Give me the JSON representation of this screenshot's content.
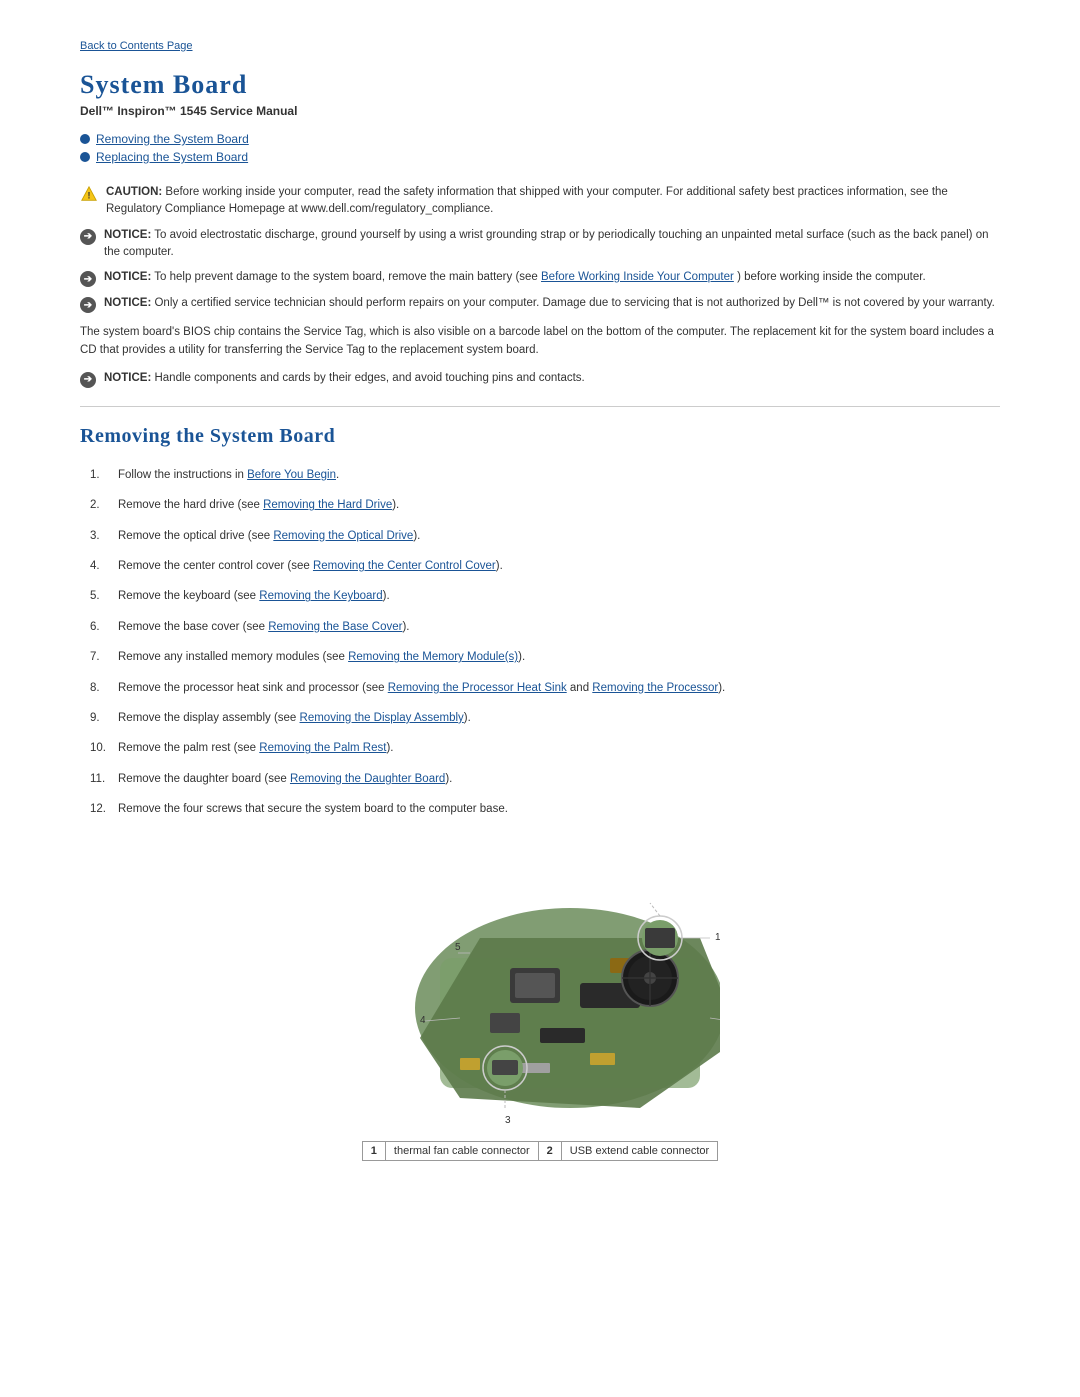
{
  "back_link": "Back to Contents Page",
  "page_title": "System Board",
  "subtitle": "Dell™ Inspiron™ 1545 Service Manual",
  "toc": [
    {
      "label": "Removing the System Board",
      "href": "#removing"
    },
    {
      "label": "Replacing the System Board",
      "href": "#replacing"
    }
  ],
  "notices": [
    {
      "type": "caution",
      "label": "CAUTION:",
      "text": "Before working inside your computer, read the safety information that shipped with your computer. For additional safety best practices information, see the Regulatory Compliance Homepage at www.dell.com/regulatory_compliance."
    },
    {
      "type": "notice",
      "label": "NOTICE:",
      "text": "To avoid electrostatic discharge, ground yourself by using a wrist grounding strap or by periodically touching an unpainted metal surface (such as the back panel) on the computer."
    },
    {
      "type": "notice",
      "label": "NOTICE:",
      "text": "To help prevent damage to the system board, remove the main battery (see Before Working Inside Your Computer) before working inside the computer."
    },
    {
      "type": "notice",
      "label": "NOTICE:",
      "text": "Only a certified service technician should perform repairs on your computer. Damage due to servicing that is not authorized by Dell™ is not covered by your warranty."
    }
  ],
  "body_paragraph": "The system board's BIOS chip contains the Service Tag, which is also visible on a barcode label on the bottom of the computer. The replacement kit for the system board includes a CD that provides a utility for transferring the Service Tag to the replacement system board.",
  "second_notice": {
    "label": "NOTICE:",
    "text": "Handle components and cards by their edges, and avoid touching pins and contacts."
  },
  "section_title": "Removing the System Board",
  "steps": [
    {
      "text": "Follow the instructions in ",
      "link": "Before You Begin",
      "after": "."
    },
    {
      "text": "Remove the hard drive (see ",
      "link": "Removing the Hard Drive",
      "after": ")."
    },
    {
      "text": "Remove the optical drive (see ",
      "link": "Removing the Optical Drive",
      "after": ")."
    },
    {
      "text": "Remove the center control cover (see ",
      "link": "Removing the Center Control Cover",
      "after": ")."
    },
    {
      "text": "Remove the keyboard (see ",
      "link": "Removing the Keyboard",
      "after": ")."
    },
    {
      "text": "Remove the base cover (see ",
      "link": "Removing the Base Cover",
      "after": ")."
    },
    {
      "text": "Remove any installed memory modules (see ",
      "link": "Removing the Memory Module(s)",
      "after": ")."
    },
    {
      "text": "Remove the processor heat sink and processor (see ",
      "link": "Removing the Processor Heat Sink",
      "link2": "Removing the Processor",
      "middle": " and ",
      "after": ")."
    },
    {
      "text": "Remove the display assembly (see ",
      "link": "Removing the Display Assembly",
      "after": ")."
    },
    {
      "text": "Remove the palm rest (see ",
      "link": "Removing the Palm Rest",
      "after": ")."
    },
    {
      "text": "Remove the daughter board (see ",
      "link": "Removing the Daughter Board",
      "after": ")."
    },
    {
      "text": "Remove the four screws that secure the system board to the computer base.",
      "link": null,
      "after": ""
    }
  ],
  "caption": [
    {
      "num": "1",
      "text": "thermal fan cable connector"
    },
    {
      "num": "2",
      "text": "USB extend cable connector"
    }
  ]
}
